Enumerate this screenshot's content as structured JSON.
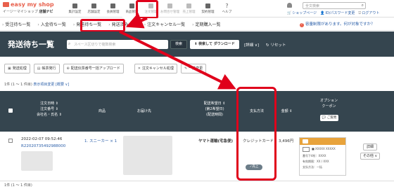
{
  "header": {
    "logo_text": "easy my shop",
    "logo_sub": "イージーマイショップ",
    "logo_sub_bold": "店舗ナビ",
    "nav": [
      {
        "label": "集計設定",
        "icon": "home-icon"
      },
      {
        "label": "店舗設定",
        "icon": "gear-icon"
      },
      {
        "label": "会員管理",
        "icon": "users-icon"
      },
      {
        "label": "商品管理",
        "icon": "shop-icon"
      },
      {
        "label": "注文管理",
        "icon": "document-icon"
      },
      {
        "label": "お問合せ管理",
        "icon": "mail-icon"
      },
      {
        "label": "売上管理",
        "icon": "chart-icon"
      },
      {
        "label": "契約管理",
        "icon": "contract-icon"
      },
      {
        "label": "ヘルプ",
        "icon": "question-icon"
      }
    ],
    "search_placeholder": "全文検索",
    "links": [
      "ショップページ",
      "ID/パスワード変更",
      "ログアウト"
    ]
  },
  "subnav": {
    "items": [
      "受注待ち一覧",
      "入金待ち一覧",
      "発送待ち一覧",
      "発送済み一覧",
      "注文キャンセル一覧",
      "定期購入一覧"
    ],
    "notice": "容量制限があります。何が対象ですか？"
  },
  "title": {
    "page_title": "発送待ち一覧",
    "search_placeholder": "スペース区切りで複数検索",
    "search_button": "検索",
    "download_button": "検索して ダウンロード",
    "detail_link": "[詳細 ∨]",
    "reset_link": "リセット"
  },
  "actions": [
    "発送処理",
    "帳票発行",
    "配送伝票番号一括アップロード",
    "注文キャンセル処理",
    "一括変更"
  ],
  "count_line": {
    "text": "1件 (1 ～ 1 件目)",
    "display_link": "表示項目変更",
    "detail_link": "[概要 ∨]"
  },
  "table": {
    "headers": {
      "order": [
        "注文日時 ⇕",
        "注文番号 ⇕",
        "会社名・氏名 ⇕"
      ],
      "product": "商品",
      "ship_to": "お届け先",
      "delivery": [
        "配送希望日 ⇕",
        "(第2希望日)",
        "(配送時間)"
      ],
      "payment": "支払方法",
      "amount": "金額 ⇕",
      "option": [
        "オプション",
        "クーポン"
      ],
      "coupon_btn": "ご質問"
    },
    "row": {
      "date": "2022-02-07 09:52:46",
      "order_no": "R22020735492988000",
      "product": "1. スニーカー × 1",
      "carrier": "ヤマト運輸(宅急便)",
      "payment": "クレジットカード",
      "payment_badge": "売上",
      "amount": "3,496円",
      "card_lines": [
        "■ XXXXX XXXXX",
        "番号下4桁：XXXX",
        "有効期限：XX / XXX",
        "支払方法：一括"
      ],
      "detail_button": "詳細",
      "other_button": "その他 ∨"
    }
  },
  "footer_count": "1件 (1 ～ 1 件目)"
}
